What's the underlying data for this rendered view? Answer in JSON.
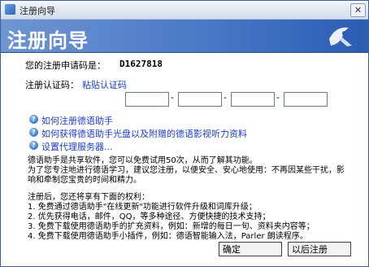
{
  "window": {
    "title": "注册向导",
    "close_label": "✕"
  },
  "banner": {
    "title": "注册向导"
  },
  "request_code": {
    "label": "您的注册申请码是：",
    "value": "D1627818"
  },
  "auth_code": {
    "label": "注册认证码：",
    "paste_link": "粘贴认证码"
  },
  "help_links": [
    "如何注册德语助手",
    "如何获得德语助手光盘以及附赠的德语影视听力资料",
    "设置代理服务器..."
  ],
  "intro": {
    "line1": "德语助手是共享软件，您可以免费试用50次，从而了解其功能。",
    "line2": "为了您专注地进行德语学习，建议您注册，以便安全、安心地使用：不再因某些干扰，影",
    "line3": "响和牵制您宝贵的时间和精力。"
  },
  "rights": {
    "heading": "注册后，您还将享有下面的权利：",
    "items": [
      "1. 免费通过德语助手\"在线更新\"功能进行软件升级和词库升级；",
      "2. 优先获得电话，邮件，QQ，等多种途径、方便快捷的技术支持；",
      "3. 免费下载使用德语助手的扩充资料，例如：新增的每日一句、资料夹内容等；",
      "4. 免费下载使用德语助手小插件，例如：德语智能输入法，Parler 朗读程序。"
    ]
  },
  "buttons": {
    "ok": "确定",
    "later": "以后注册"
  },
  "icons": {
    "help": "help-icon",
    "logo": "dehelper-logo"
  },
  "colors": {
    "banner": "#4a79c6",
    "link": "#1b3bd1"
  }
}
